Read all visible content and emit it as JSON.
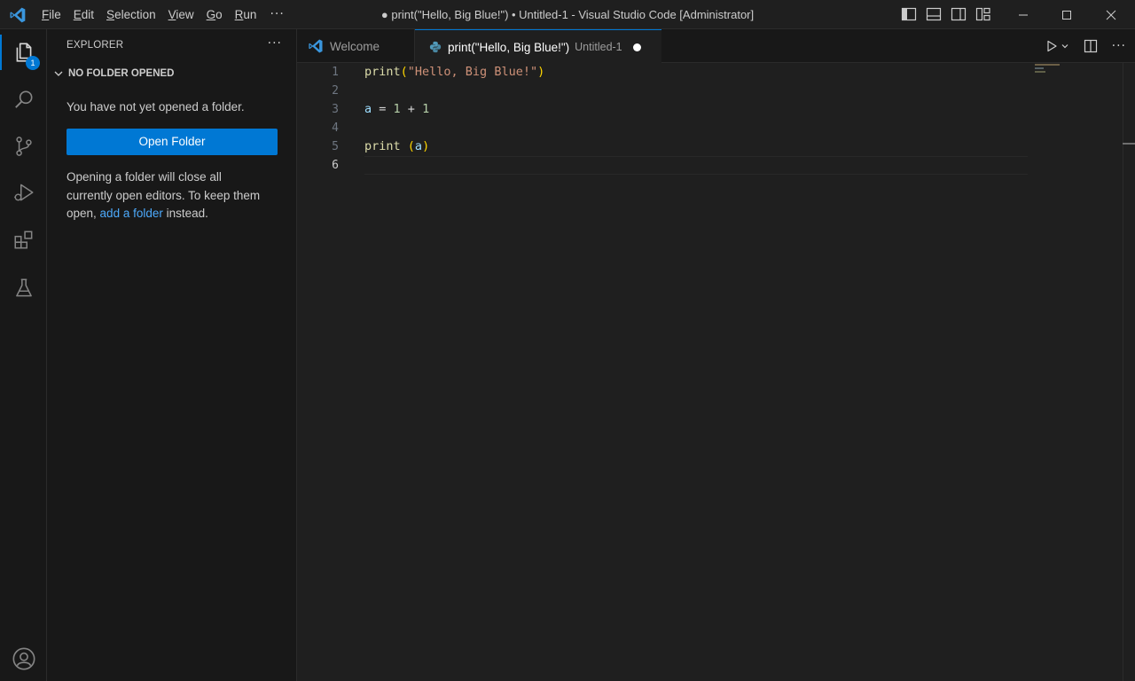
{
  "titlebar": {
    "menu": [
      {
        "pre": "",
        "u": "F",
        "post": "ile"
      },
      {
        "pre": "",
        "u": "E",
        "post": "dit"
      },
      {
        "pre": "",
        "u": "S",
        "post": "election"
      },
      {
        "pre": "",
        "u": "V",
        "post": "iew"
      },
      {
        "pre": "",
        "u": "G",
        "post": "o"
      },
      {
        "pre": "",
        "u": "R",
        "post": "un"
      }
    ],
    "more": "···",
    "window_title": "● print(\"Hello, Big Blue!\") • Untitled-1 - Visual Studio Code [Administrator]"
  },
  "activity_bar": {
    "explorer_badge": "1",
    "items": [
      "files-icon",
      "search-icon",
      "source-control-icon",
      "run-debug-icon",
      "extensions-icon",
      "testing-icon",
      "account-icon"
    ]
  },
  "sidebar": {
    "header": "EXPLORER",
    "more": "···",
    "section": "NO FOLDER OPENED",
    "message": "You have not yet opened a folder.",
    "button": "Open Folder",
    "note_line1": "Opening a folder will close all",
    "note_line2": "currently open editors. To keep them",
    "note_pre": "open, ",
    "note_link": "add a folder",
    "note_post": " instead."
  },
  "tabs": {
    "welcome": "Welcome",
    "active_title": "print(\"Hello, Big Blue!\")",
    "active_desc": "Untitled-1"
  },
  "editor": {
    "line_numbers": [
      "1",
      "2",
      "3",
      "4",
      "5",
      "6"
    ],
    "current_line": 6,
    "code": {
      "l1_fn": "print",
      "l1_open": "(",
      "l1_str": "\"Hello, Big Blue!\"",
      "l1_close": ")",
      "l3_var": "a",
      "l3_eq": " = ",
      "l3_n1": "1",
      "l3_plus": " + ",
      "l3_n2": "1",
      "l5_fn": "print",
      "l5_space": " ",
      "l5_open": "(",
      "l5_var": "a",
      "l5_close": ")"
    }
  },
  "colors": {
    "accent": "#0078d4",
    "background": "#1f1f1f",
    "sidebar": "#181818",
    "link": "#4daafc"
  }
}
